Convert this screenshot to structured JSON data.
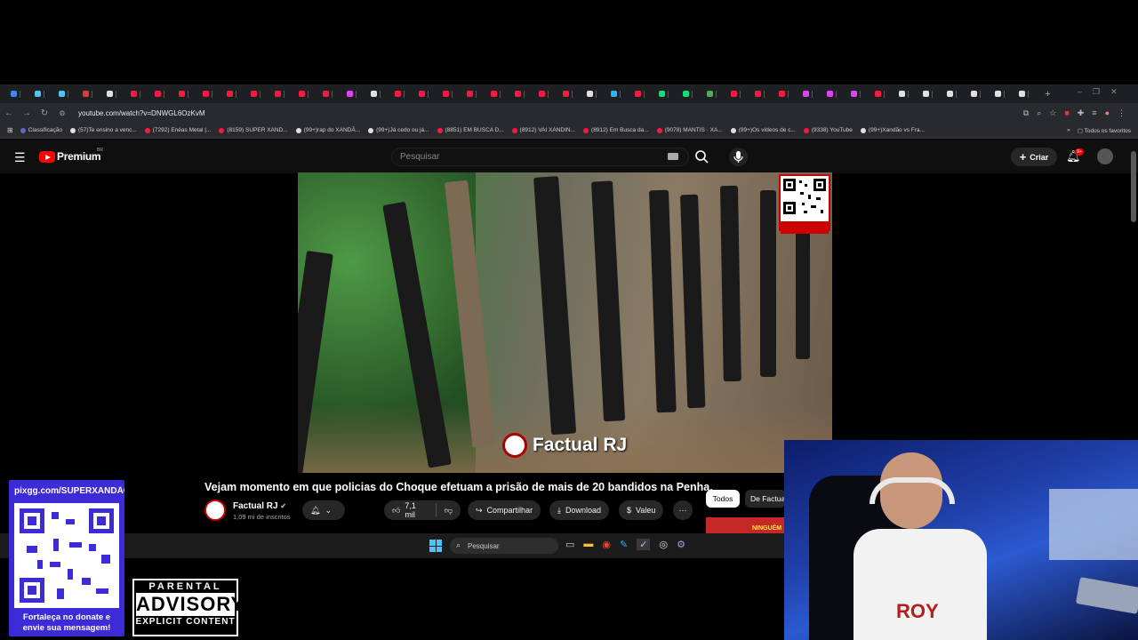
{
  "browser": {
    "url": "youtube.com/watch?v=DNWGL6OzKvM",
    "tab_colors": [
      "#4285f4",
      "#4fc3f7",
      "#4fc3f7",
      "#e53935",
      "#e0e0e0",
      "#ff1744",
      "#ff1744",
      "#ff1744",
      "#ff1744",
      "#ff1744",
      "#ff1744",
      "#ff1744",
      "#ff1744",
      "#ff1744",
      "#e040fb",
      "#e0e0e0",
      "#ff1744",
      "#ff1744",
      "#ff1744",
      "#ff1744",
      "#ff1744",
      "#ff1744",
      "#ff1744",
      "#ff1744",
      "#e0e0e0",
      "#29b6f6",
      "#ff1744",
      "#00e676",
      "#00e676",
      "#4caf50",
      "#ff1744",
      "#ff1744",
      "#ff1744",
      "#e040fb",
      "#e040fb",
      "#e040fb",
      "#ff1744",
      "#e0e0e0",
      "#e0e0e0",
      "#e0e0e0",
      "#e0e0e0",
      "#e0e0e0",
      "#e0e0e0"
    ],
    "bookmarks": [
      {
        "label": "Classificação",
        "color": "#5c6bc0"
      },
      {
        "label": "(57)Te ensino a venc...",
        "color": "#e0e0e0"
      },
      {
        "label": "(7292) Enéas Metal |...",
        "color": "#ff1744"
      },
      {
        "label": "(8159) SUPER XAND...",
        "color": "#ff1744"
      },
      {
        "label": "(99+)rap do XANDÃ...",
        "color": "#e0e0e0"
      },
      {
        "label": "(99+)Já cedo ou já...",
        "color": "#e0e0e0"
      },
      {
        "label": "(8851) EM BUSCA D...",
        "color": "#ff1744"
      },
      {
        "label": "(8912) VAI XANDIN...",
        "color": "#ff1744"
      },
      {
        "label": "(8912) Em Busca da...",
        "color": "#ff1744"
      },
      {
        "label": "(9078) MANTIS · XA...",
        "color": "#ff1744"
      },
      {
        "label": "(99+)Os vídeos de c...",
        "color": "#e0e0e0"
      },
      {
        "label": "(9338) YouTube",
        "color": "#ff1744"
      },
      {
        "label": "(99+)Xandão vs Fra...",
        "color": "#e0e0e0"
      }
    ],
    "all_bookmarks": "Todos os favoritos"
  },
  "youtube": {
    "logo_text": "Premium",
    "logo_region": "BR",
    "search_placeholder": "Pesquisar",
    "create_label": "Criar",
    "notifications_badge": "9+",
    "video_watermark": "Factual RJ",
    "video_title": "Vejam momento em que policias do Choque efetuam a prisão de mais de 20 bandidos na Penha.",
    "channel_name": "Factual RJ",
    "channel_subs": "1,09 mi de inscritos",
    "likes": "7,1 mil",
    "share_label": "Compartilhar",
    "download_label": "Download",
    "thanks_label": "Valeu",
    "chip_all": "Todos",
    "chip_channel": "De Factual",
    "thumbnail_text": "NINGUÉM"
  },
  "taskbar": {
    "search_placeholder": "Pesquisar"
  },
  "overlay": {
    "donate_url": "pixgg.com/SUPERXANDÃO",
    "donate_msg": "Fortaleça no donate e envie sua mensagem!",
    "advisory_top": "PARENTAL",
    "advisory_mid": "ADVISORY",
    "advisory_bottom": "EXPLICIT CONTENT",
    "webcam_shirt_text": "ROY"
  }
}
